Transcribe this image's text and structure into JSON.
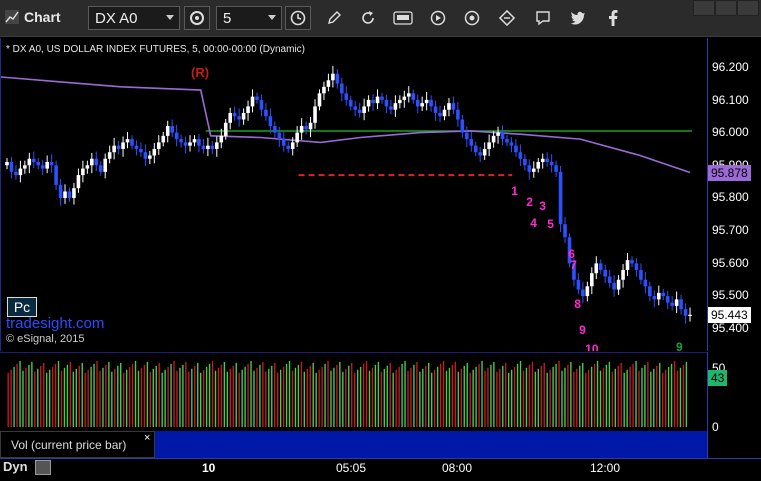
{
  "app": {
    "title": "Chart"
  },
  "toolbar": {
    "symbol": "DX A0",
    "interval": "5"
  },
  "chart": {
    "header": "* DX A0, US DOLLAR INDEX FUTURES, 5, 00:00-00:00 (Dynamic)",
    "annotation_r": "(R)",
    "pc_button": "Pc",
    "site": "tradesight.com",
    "copyright": "© eSignal, 2015",
    "price_labels": [
      "96.200",
      "96.100",
      "96.000",
      "95.900",
      "95.800",
      "95.700",
      "95.600",
      "95.500",
      "95.400"
    ],
    "ma_value_box": "95.878",
    "last_price_box": "95.443",
    "ma_color": "#9b6ad6",
    "resistance_color": "#1aa01a",
    "support_color": "#e0202a",
    "count_labels": [
      {
        "text": "1",
        "color": "#ff2ad0"
      },
      {
        "text": "2",
        "color": "#ff2ad0"
      },
      {
        "text": "3",
        "color": "#ff2ad0"
      },
      {
        "text": "4",
        "color": "#ff2ad0"
      },
      {
        "text": "5",
        "color": "#ff2ad0"
      },
      {
        "text": "6",
        "color": "#ff2ad0"
      },
      {
        "text": "7",
        "color": "#ff2ad0"
      },
      {
        "text": "8",
        "color": "#ff2ad0"
      },
      {
        "text": "9",
        "color": "#ff2ad0"
      },
      {
        "text": "10",
        "color": "#ff2ad0"
      },
      {
        "text": "9",
        "color": "#1f9e3f"
      }
    ]
  },
  "volume": {
    "label": "Vol (current price bar)",
    "axis_labels": [
      "50",
      "0"
    ],
    "value_box": "43"
  },
  "time_axis": {
    "labels": [
      "10",
      "05:05",
      "08:00",
      "12:00"
    ],
    "dyn": "Dyn"
  },
  "chart_data": {
    "type": "candlestick",
    "y_axis_range": [
      95.38,
      96.24
    ],
    "levels": [
      {
        "name": "resistance",
        "value": 96.005
      },
      {
        "name": "support",
        "value": 95.87
      }
    ],
    "closes": [
      95.91,
      95.88,
      95.87,
      95.89,
      95.9,
      95.92,
      95.91,
      95.9,
      95.89,
      95.91,
      95.9,
      95.84,
      95.8,
      95.82,
      95.8,
      95.83,
      95.87,
      95.89,
      95.9,
      95.92,
      95.9,
      95.88,
      95.92,
      95.94,
      95.96,
      95.95,
      95.97,
      95.98,
      95.96,
      95.95,
      95.94,
      95.92,
      95.93,
      95.95,
      95.97,
      95.99,
      96.02,
      96.0,
      95.98,
      95.97,
      95.96,
      95.97,
      95.98,
      95.96,
      95.95,
      95.96,
      95.95,
      95.97,
      95.99,
      96.03,
      96.06,
      96.05,
      96.04,
      96.06,
      96.08,
      96.11,
      96.1,
      96.07,
      96.05,
      96.02,
      96.0,
      95.98,
      95.96,
      95.95,
      95.97,
      96.0,
      96.02,
      96.01,
      96.03,
      96.08,
      96.12,
      96.14,
      96.16,
      96.18,
      96.15,
      96.12,
      96.1,
      96.08,
      96.07,
      96.06,
      96.08,
      96.1,
      96.09,
      96.11,
      96.1,
      96.08,
      96.07,
      96.09,
      96.1,
      96.11,
      96.12,
      96.1,
      96.08,
      96.09,
      96.1,
      96.08,
      96.06,
      96.05,
      96.07,
      96.09,
      96.07,
      96.04,
      96.0,
      95.98,
      95.96,
      95.94,
      95.93,
      95.95,
      95.97,
      95.99,
      96.0,
      95.98,
      95.97,
      95.96,
      95.94,
      95.92,
      95.9,
      95.88,
      95.89,
      95.91,
      95.92,
      95.91,
      95.9,
      95.88,
      95.72,
      95.68,
      95.6,
      95.55,
      95.52,
      95.5,
      95.53,
      95.57,
      95.6,
      95.58,
      95.56,
      95.54,
      95.52,
      95.55,
      95.58,
      95.61,
      95.6,
      95.58,
      95.55,
      95.53,
      95.5,
      95.49,
      95.51,
      95.5,
      95.48,
      95.47,
      95.49,
      95.46,
      95.44,
      95.443
    ],
    "ma_curve": [
      [
        0,
        96.17
      ],
      [
        60,
        96.155
      ],
      [
        120,
        96.14
      ],
      [
        200,
        96.13
      ],
      [
        210,
        95.99
      ],
      [
        260,
        95.985
      ],
      [
        320,
        95.97
      ],
      [
        360,
        95.985
      ],
      [
        420,
        96.0
      ],
      [
        470,
        96.005
      ],
      [
        520,
        95.995
      ],
      [
        580,
        95.98
      ],
      [
        640,
        95.93
      ],
      [
        690,
        95.878
      ]
    ]
  }
}
